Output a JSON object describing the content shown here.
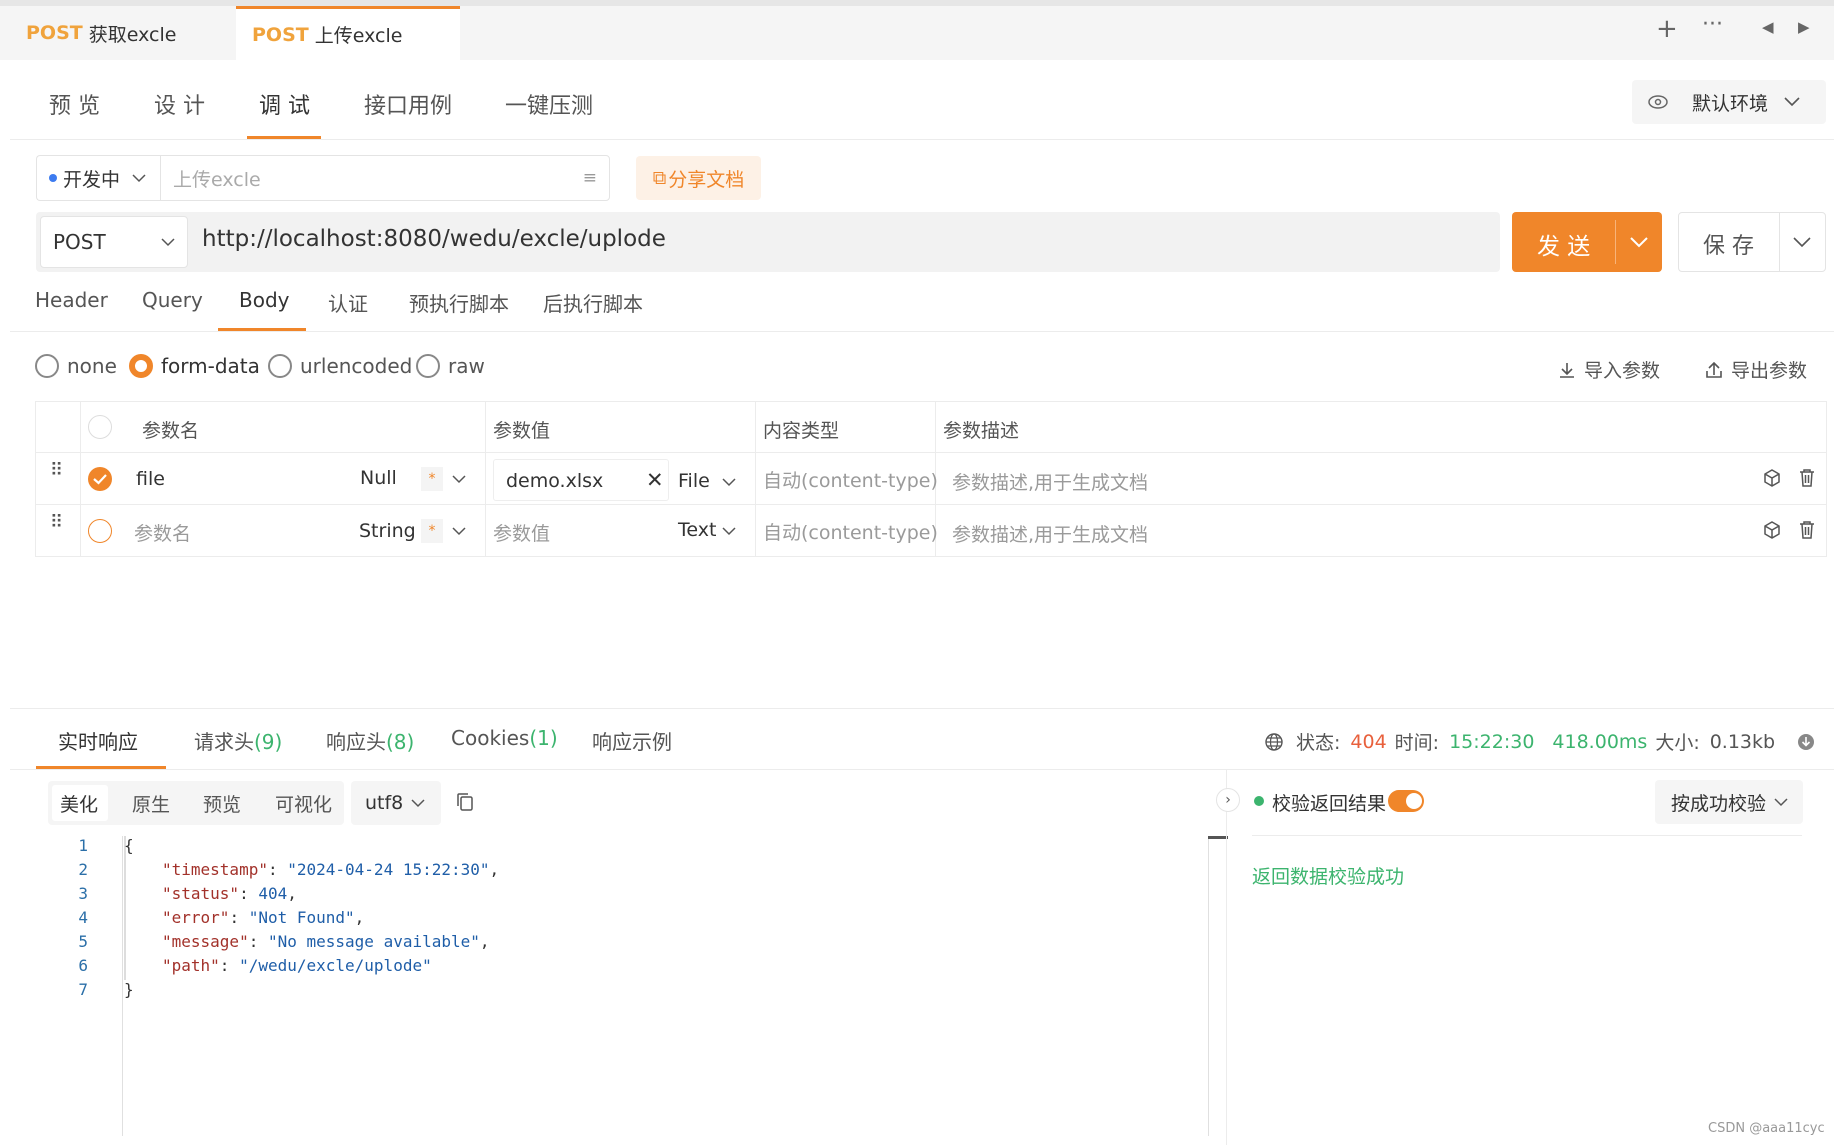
{
  "file_tabs": [
    {
      "method": "POST",
      "label": "获取excle"
    },
    {
      "method": "POST",
      "label": "上传excle"
    }
  ],
  "view_tabs": [
    "预 览",
    "设 计",
    "调 试",
    "接口用例",
    "一键压测"
  ],
  "environment": "默认环境",
  "api_status": "开发中",
  "api_name_placeholder": "上传excle",
  "share_doc": "分享文档",
  "method": "POST",
  "url": "http://localhost:8080/wedu/excle/uplode",
  "send_label": "发 送",
  "save_label": "保 存",
  "request_tabs": [
    "Header",
    "Query",
    "Body",
    "认证",
    "预执行脚本",
    "后执行脚本"
  ],
  "body_types": [
    "none",
    "form-data",
    "urlencoded",
    "raw"
  ],
  "selected_body_type": "form-data",
  "import_params": "导入参数",
  "export_params": "导出参数",
  "table_headers": [
    "参数名",
    "参数值",
    "内容类型",
    "参数描述"
  ],
  "params": [
    {
      "name": "file",
      "type": "Null",
      "required": "*",
      "value": "demo.xlsx",
      "value_type": "File",
      "content_type": "自动(content-type)",
      "description": "参数描述,用于生成文档",
      "checked": true
    },
    {
      "name": "参数名",
      "type": "String",
      "required": "*",
      "value": "参数值",
      "value_type": "Text",
      "content_type": "自动(content-type)",
      "description": "参数描述,用于生成文档",
      "checked": false
    }
  ],
  "response_tabs": {
    "realtime": "实时响应",
    "req_headers": "请求头",
    "req_headers_count": "(9)",
    "resp_headers": "响应头",
    "resp_headers_count": "(8)",
    "cookies": "Cookies",
    "cookies_count": "(1)",
    "examples": "响应示例"
  },
  "response_meta": {
    "status_label": "状态:",
    "status": "404",
    "time_label": "时间:",
    "time": "15:22:30",
    "duration": "418.00ms",
    "size_label": "大小:",
    "size": "0.13kb"
  },
  "format_tabs": [
    "美化",
    "原生",
    "预览",
    "可视化"
  ],
  "encoding": "utf8",
  "code_lines": [
    "1",
    "2",
    "3",
    "4",
    "5",
    "6",
    "7"
  ],
  "response_json": {
    "timestamp": "\"2024-04-24 15:22:30\"",
    "status": "404",
    "error": "\"Not Found\"",
    "message": "\"No message available\"",
    "path": "\"/wedu/excle/uplode\""
  },
  "validate_label": "校验返回结果",
  "validate_mode": "按成功校验",
  "validate_result": "返回数据校验成功",
  "watermark": "CSDN @aaa11cyc",
  "colors": {
    "accent": "#f0862a",
    "success": "#3cb46e",
    "error_status": "#e8603c"
  }
}
